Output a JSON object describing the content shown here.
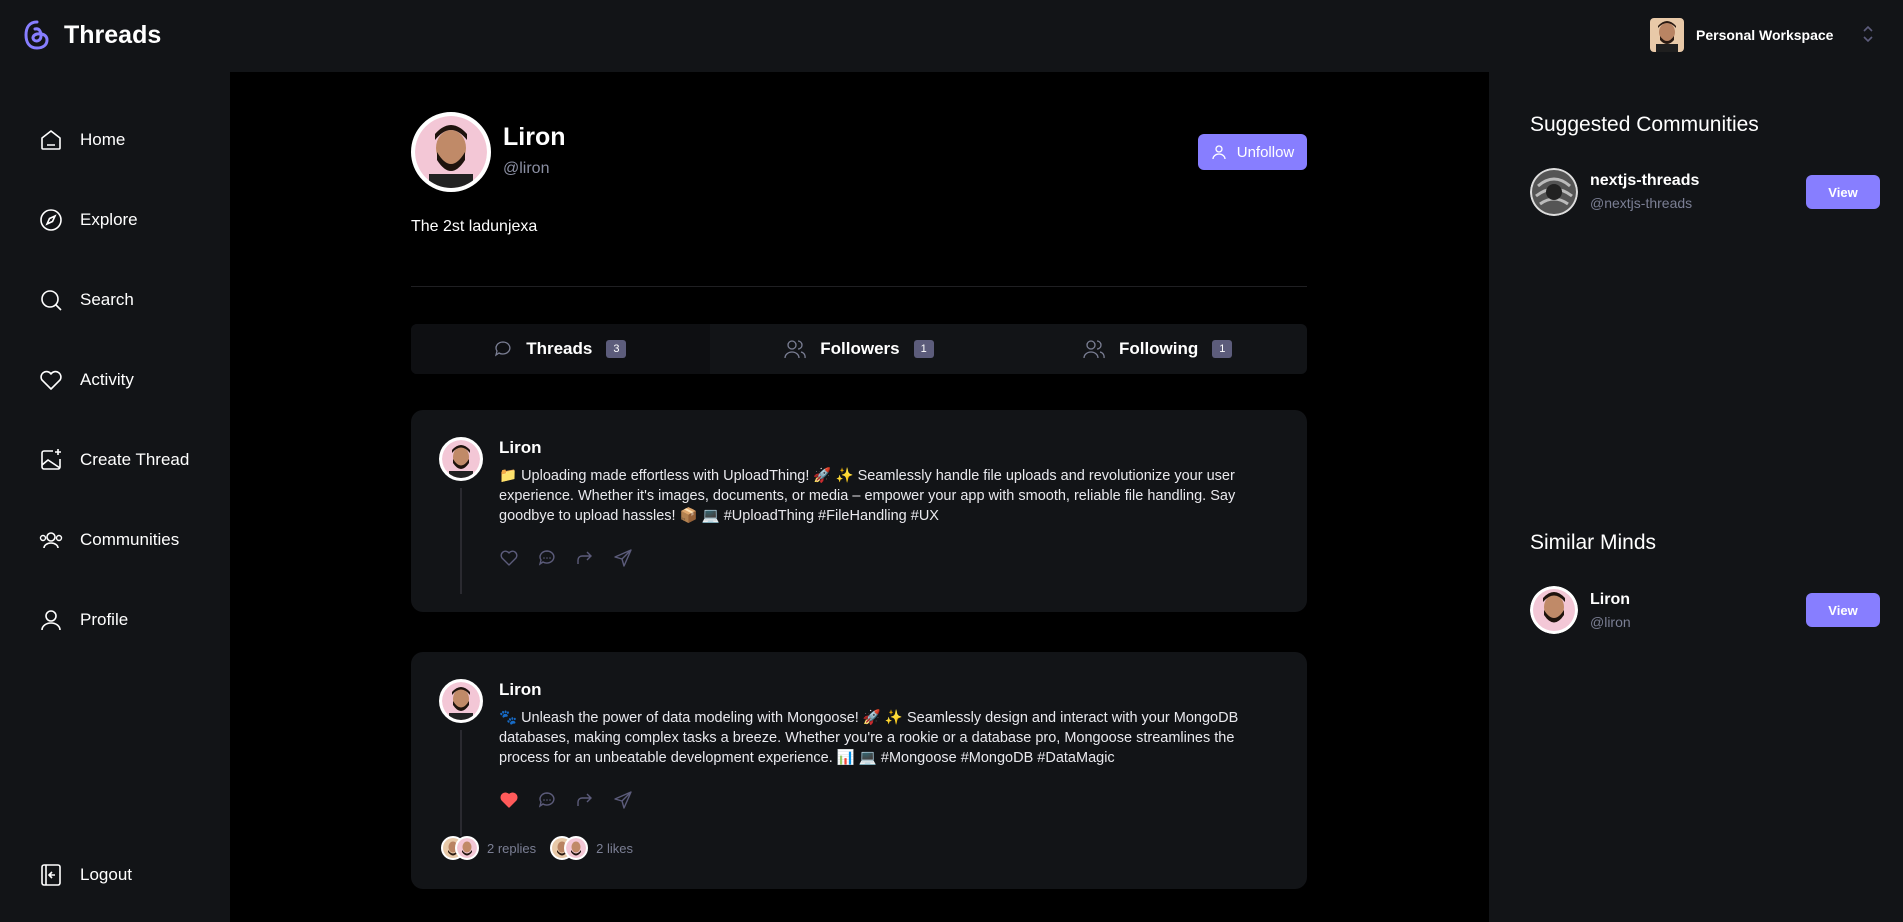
{
  "app": {
    "name": "Threads"
  },
  "workspace": {
    "label": "Personal Workspace"
  },
  "nav": {
    "home": "Home",
    "explore": "Explore",
    "search": "Search",
    "activity": "Activity",
    "create": "Create Thread",
    "communities": "Communities",
    "profile": "Profile",
    "logout": "Logout"
  },
  "profile": {
    "name": "Liron",
    "handle": "@liron",
    "bio": "The 2st ladunjexa",
    "unfollow_label": "Unfollow"
  },
  "tabs": [
    {
      "label": "Threads",
      "count": "3"
    },
    {
      "label": "Followers",
      "count": "1"
    },
    {
      "label": "Following",
      "count": "1"
    }
  ],
  "threads": [
    {
      "author": "Liron",
      "text": "📁 Uploading made effortless with UploadThing! 🚀 ✨ Seamlessly handle file uploads and revolutionize your user experience. Whether it's images, documents, or media – empower your app with smooth, reliable file handling. Say goodbye to upload hassles! 📦 💻 #UploadThing #FileHandling #UX",
      "liked": false
    },
    {
      "author": "Liron",
      "text": "🐾 Unleash the power of data modeling with Mongoose! 🚀 ✨ Seamlessly design and interact with your MongoDB databases, making complex tasks a breeze. Whether you're a rookie or a database pro, Mongoose streamlines the process for an unbeatable development experience. 📊 💻 #Mongoose #MongoDB #DataMagic",
      "liked": true,
      "replies": "2 replies",
      "likes": "2 likes"
    }
  ],
  "sidebar": {
    "communities_title": "Suggested Communities",
    "communities": [
      {
        "name": "nextjs-threads",
        "handle": "@nextjs-threads",
        "button": "View"
      }
    ],
    "minds_title": "Similar Minds",
    "minds": [
      {
        "name": "Liron",
        "handle": "@liron",
        "button": "View"
      }
    ]
  },
  "colors": {
    "accent": "#877eff",
    "like": "#ff5a5a",
    "bg_dark": "#121417",
    "bg_main": "#000000"
  }
}
